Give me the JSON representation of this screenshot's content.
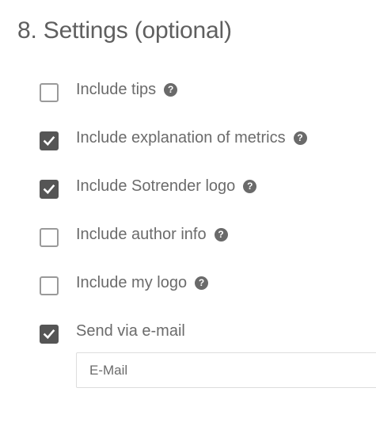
{
  "section": {
    "title": "8. Settings (optional)"
  },
  "options": [
    {
      "label": "Include tips",
      "checked": false,
      "has_help": true,
      "help_icon": "question-circle-icon"
    },
    {
      "label": "Include explanation of metrics",
      "checked": true,
      "has_help": true,
      "help_icon": "question-circle-icon"
    },
    {
      "label": "Include Sotrender logo",
      "checked": true,
      "has_help": true,
      "help_icon": "question-circle-icon"
    },
    {
      "label": "Include author info",
      "checked": false,
      "has_help": true,
      "help_icon": "question-circle-icon"
    },
    {
      "label": "Include my logo",
      "checked": false,
      "has_help": true,
      "help_icon": "question-circle-icon"
    },
    {
      "label": "Send via e-mail",
      "checked": true,
      "has_help": false
    }
  ],
  "email": {
    "placeholder": "E-Mail",
    "value": ""
  },
  "colors": {
    "checked_fill": "#555555",
    "unchecked_border": "#9a9a9a",
    "text": "#6b6b6b",
    "title": "#5f5f5f"
  }
}
